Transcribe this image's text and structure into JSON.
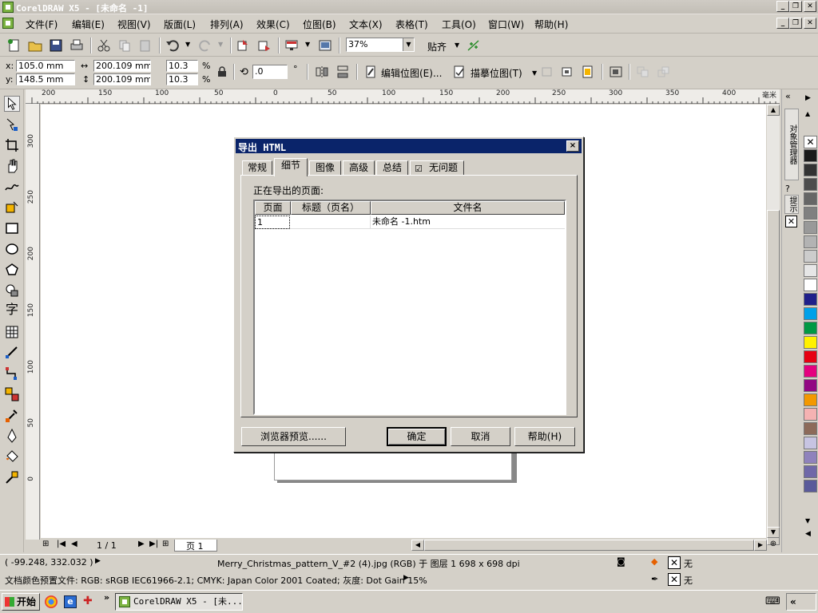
{
  "window": {
    "title": "CorelDRAW X5 - [未命名 -1]"
  },
  "menu": [
    "文件(F)",
    "编辑(E)",
    "视图(V)",
    "版面(L)",
    "排列(A)",
    "效果(C)",
    "位图(B)",
    "文本(X)",
    "表格(T)",
    "工具(O)",
    "窗口(W)",
    "帮助(H)"
  ],
  "toolbar": {
    "zoom": "37%",
    "snap_label": "贴齐"
  },
  "propbar": {
    "x_label": "x:",
    "x": "105.0 mm",
    "y_label": "y:",
    "y": "148.5 mm",
    "w": "200.109 mm",
    "h": "200.109 mm",
    "scale_w": "10.3",
    "scale_h": "10.3",
    "pct": "%",
    "rotation": ".0",
    "degree": "°",
    "edit_bitmap": "编辑位图(E)...",
    "trace_bitmap": "描摹位图(T)"
  },
  "ruler": {
    "unit": "毫米",
    "h_ticks": [
      "200",
      "150",
      "100",
      "50",
      "0",
      "50",
      "100",
      "150",
      "200",
      "250",
      "300",
      "350",
      "400"
    ],
    "v_ticks": [
      "300",
      "250",
      "200",
      "150",
      "100",
      "50",
      "0"
    ]
  },
  "docker": {
    "tab1": "对象管理器",
    "tab2": "提示"
  },
  "palette": [
    "#ffffff",
    "#1a1a1a",
    "#333333",
    "#4d4d4d",
    "#666666",
    "#808080",
    "#999999",
    "#b3b3b3",
    "#cccccc",
    "#e6e6e6",
    "#ffffff",
    "#1f1f8a",
    "#00a0e9",
    "#009944",
    "#fff100",
    "#e60012",
    "#e4007f",
    "#920783",
    "#f39800",
    "#f5b2b2",
    "#8c6a5a",
    "#c7c4e2",
    "#8f82bc",
    "#6f68a8",
    "#5a5a9a"
  ],
  "pagenav": {
    "count": "1 / 1",
    "tab": "页 1"
  },
  "status": {
    "coords": "( -99.248, 332.032 )",
    "object": "Merry_Christmas_pattern_V_#2 (4).jpg (RGB) 于 图层 1 698 x 698 dpi",
    "color_profile": "文档颜色预置文件: RGB: sRGB IEC61966-2.1; CMYK: Japan Color 2001 Coated; 灰度: Dot Gain 15%",
    "fill_none": "无",
    "outline_none": "无"
  },
  "taskbar": {
    "start": "开始",
    "app": "CorelDRAW X5 - [未..."
  },
  "dialog": {
    "title": "导出 HTML",
    "close": "×",
    "tabs": [
      "常规",
      "细节",
      "图像",
      "高级",
      "总结",
      "无问题"
    ],
    "active_tab": 1,
    "pages_label": "正在导出的页面:",
    "columns": [
      "页面",
      "标题（页名）",
      "文件名"
    ],
    "rows": [
      {
        "page": "1",
        "title": "",
        "filename": "未命名 -1.htm"
      }
    ],
    "buttons": {
      "preview": "浏览器预览......",
      "ok": "确定",
      "cancel": "取消",
      "help": "帮助(H)"
    }
  }
}
